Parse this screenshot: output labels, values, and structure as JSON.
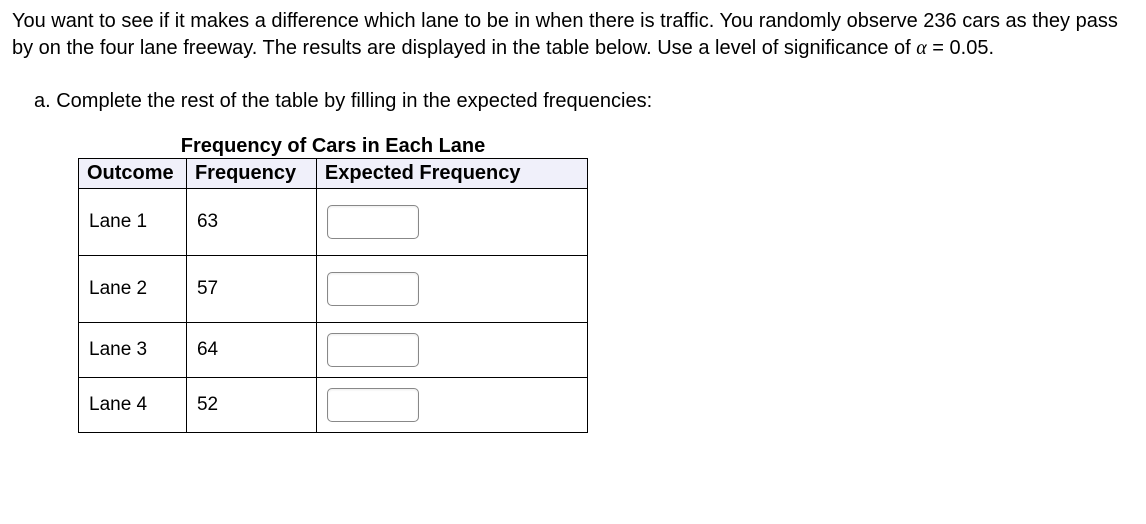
{
  "problem_text": "You want to see if it makes a difference which lane to be in when there is traffic. You randomly observe 236 cars as they pass by on the four lane freeway. The results are displayed in the table below.  Use a level of significance of ",
  "alpha_symbol": "α",
  "alpha_value": " = 0.05.",
  "question_a": "a. Complete the rest of the table by filling in the expected frequencies:",
  "table_title": "Frequency of Cars in Each Lane",
  "headers": {
    "outcome": "Outcome",
    "frequency": "Frequency",
    "expected": "Expected Frequency"
  },
  "rows": [
    {
      "outcome": "Lane 1",
      "frequency": "63",
      "expected": ""
    },
    {
      "outcome": "Lane 2",
      "frequency": "57",
      "expected": ""
    },
    {
      "outcome": "Lane 3",
      "frequency": "64",
      "expected": ""
    },
    {
      "outcome": "Lane 4",
      "frequency": "52",
      "expected": ""
    }
  ]
}
